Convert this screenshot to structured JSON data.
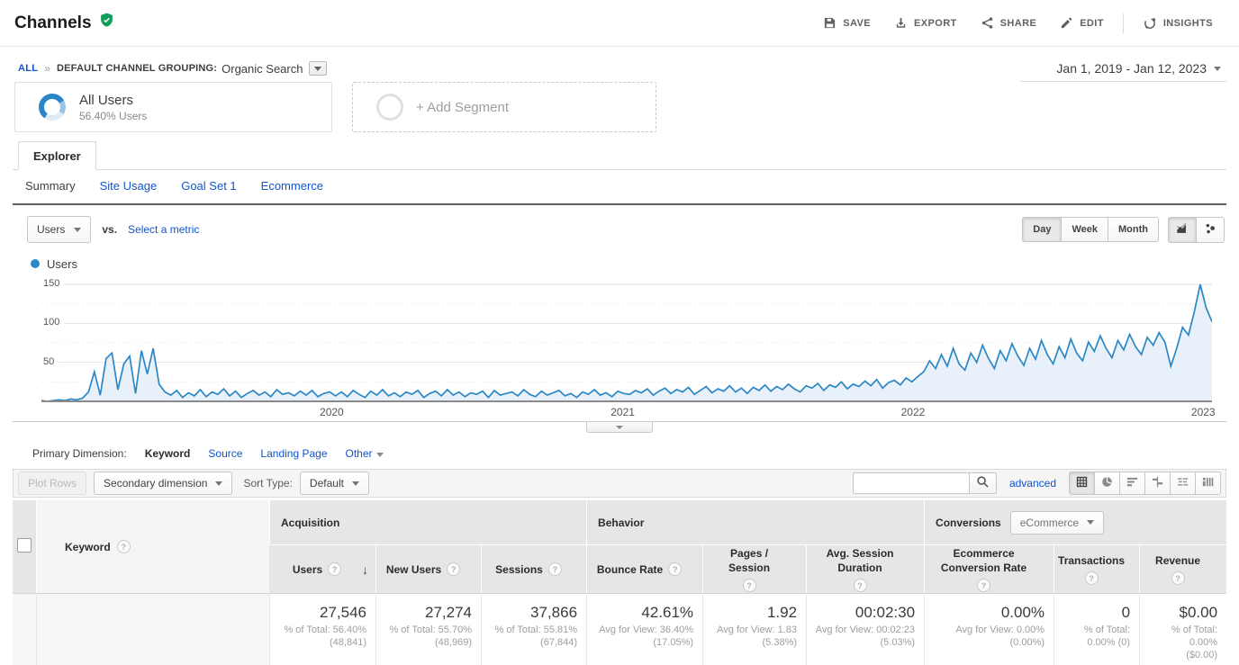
{
  "colors": {
    "accent_link": "#1155cc",
    "chart_line": "#2b87c5",
    "chart_fill": "#e8f1f9",
    "verified_green": "#0f9d58"
  },
  "header": {
    "title": "Channels",
    "actions": [
      {
        "name": "save",
        "label": "SAVE",
        "icon": "save-icon"
      },
      {
        "name": "export",
        "label": "EXPORT",
        "icon": "export-icon"
      },
      {
        "name": "share",
        "label": "SHARE",
        "icon": "share-icon"
      },
      {
        "name": "edit",
        "label": "EDIT",
        "icon": "edit-icon"
      },
      {
        "name": "insights",
        "label": "INSIGHTS",
        "icon": "insights-icon",
        "divider_before": true
      }
    ]
  },
  "breadcrumb": {
    "all": "ALL",
    "sep": "»",
    "grouping_label": "DEFAULT CHANNEL GROUPING:",
    "grouping_value": "Organic Search"
  },
  "date_range": "Jan 1, 2019 - Jan 12, 2023",
  "segments": {
    "all_users": {
      "title": "All Users",
      "subtitle": "56.40% Users",
      "percent": 56.4
    },
    "add_label": "+ Add Segment"
  },
  "explorer_tab": "Explorer",
  "subtabs": [
    {
      "label": "Summary",
      "active": true
    },
    {
      "label": "Site Usage",
      "active": false
    },
    {
      "label": "Goal Set 1",
      "active": false
    },
    {
      "label": "Ecommerce",
      "active": false
    }
  ],
  "metric_picker": {
    "selected": "Users",
    "vs": "vs.",
    "select_link": "Select a metric"
  },
  "granularity": {
    "options": [
      "Day",
      "Week",
      "Month"
    ],
    "active": "Day"
  },
  "chart_type_buttons": [
    {
      "name": "line-chart-view",
      "active": true
    },
    {
      "name": "motion-chart-view",
      "active": false
    }
  ],
  "legend": "Users",
  "chart_data": {
    "type": "line",
    "title": "Users",
    "x_start": "Jan 1, 2019",
    "x_end": "Jan 12, 2023",
    "x_ticks": [
      {
        "label": "2020",
        "frac": 0.248
      },
      {
        "label": "2021",
        "frac": 0.4966
      },
      {
        "label": "2022",
        "frac": 0.7446
      },
      {
        "label": "2023",
        "frac": 0.9925
      }
    ],
    "y_ticks": [
      50,
      100,
      150
    ],
    "y_midticks": [
      25,
      75,
      125
    ],
    "ylim": [
      0,
      165
    ],
    "grid": true,
    "legend_position": "top-left",
    "series": [
      {
        "name": "Users",
        "values": [
          1,
          0,
          1,
          2,
          1,
          3,
          2,
          4,
          12,
          38,
          8,
          55,
          62,
          15,
          48,
          58,
          10,
          65,
          35,
          68,
          22,
          12,
          8,
          14,
          5,
          11,
          7,
          15,
          6,
          12,
          9,
          16,
          7,
          13,
          5,
          10,
          14,
          8,
          12,
          6,
          15,
          9,
          11,
          7,
          13,
          8,
          14,
          6,
          10,
          12,
          7,
          12,
          6,
          14,
          9,
          5,
          13,
          8,
          15,
          7,
          11,
          6,
          12,
          9,
          14,
          5,
          10,
          13,
          7,
          15,
          8,
          12,
          6,
          11,
          9,
          13,
          5,
          14,
          8,
          10,
          12,
          7,
          15,
          9,
          6,
          13,
          8,
          11,
          14,
          7,
          10,
          5,
          12,
          9,
          15,
          8,
          11,
          6,
          13,
          10,
          9,
          14,
          11,
          16,
          8,
          13,
          17,
          10,
          15,
          12,
          18,
          9,
          14,
          19,
          11,
          16,
          13,
          20,
          12,
          17,
          10,
          18,
          14,
          21,
          13,
          19,
          15,
          22,
          16,
          12,
          20,
          17,
          23,
          14,
          21,
          18,
          25,
          16,
          22,
          19,
          26,
          20,
          28,
          17,
          24,
          27,
          21,
          30,
          25,
          32,
          38,
          52,
          42,
          60,
          45,
          68,
          48,
          40,
          62,
          50,
          72,
          55,
          42,
          65,
          52,
          74,
          58,
          46,
          68,
          54,
          78,
          60,
          48,
          70,
          56,
          80,
          62,
          52,
          76,
          64,
          84,
          68,
          56,
          78,
          66,
          86,
          70,
          60,
          82,
          72,
          88,
          76,
          45,
          68,
          95,
          85,
          115,
          150,
          120,
          102
        ]
      }
    ]
  },
  "primary_dimension": {
    "label": "Primary Dimension:",
    "options": [
      {
        "label": "Keyword",
        "active": true,
        "dropdown": false
      },
      {
        "label": "Source",
        "active": false,
        "dropdown": false
      },
      {
        "label": "Landing Page",
        "active": false,
        "dropdown": false
      },
      {
        "label": "Other",
        "active": false,
        "dropdown": true
      }
    ]
  },
  "table_toolbar": {
    "plot_rows": "Plot Rows",
    "secondary_dimension": "Secondary dimension",
    "sort_type_label": "Sort Type:",
    "sort_type_value": "Default",
    "search_placeholder": "",
    "advanced": "advanced",
    "view_buttons": [
      {
        "name": "data-view",
        "active": true
      },
      {
        "name": "percentage-view",
        "active": false
      },
      {
        "name": "performance-view",
        "active": false
      },
      {
        "name": "comparison-view",
        "active": false
      },
      {
        "name": "term-cloud-view",
        "active": false
      },
      {
        "name": "pivot-view",
        "active": false
      }
    ]
  },
  "table": {
    "row_header": "Keyword",
    "conversions_dropdown": "eCommerce",
    "groups": [
      {
        "label": "Acquisition",
        "span": 3,
        "dropdown": null
      },
      {
        "label": "Behavior",
        "span": 3,
        "dropdown": null
      },
      {
        "label": "Conversions",
        "span": 3,
        "dropdown": "eCommerce"
      }
    ],
    "columns": [
      {
        "label": "Users",
        "sorted": "desc"
      },
      {
        "label": "New Users",
        "sorted": null
      },
      {
        "label": "Sessions",
        "sorted": null
      },
      {
        "label": "Bounce Rate",
        "sorted": null
      },
      {
        "label": "Pages / Session",
        "sorted": null
      },
      {
        "label": "Avg. Session Duration",
        "sorted": null
      },
      {
        "label": "Ecommerce Conversion Rate",
        "sorted": null
      },
      {
        "label": "Transactions",
        "sorted": null
      },
      {
        "label": "Revenue",
        "sorted": null
      }
    ],
    "totals": [
      {
        "main": "27,546",
        "sub": "% of Total: 56.40%",
        "sub2": "(48,841)"
      },
      {
        "main": "27,274",
        "sub": "% of Total: 55.70%",
        "sub2": "(48,969)"
      },
      {
        "main": "37,866",
        "sub": "% of Total: 55.81%",
        "sub2": "(67,844)"
      },
      {
        "main": "42.61%",
        "sub": "Avg for View: 36.40%",
        "sub2": "(17.05%)"
      },
      {
        "main": "1.92",
        "sub": "Avg for View: 1.83",
        "sub2": "(5.38%)"
      },
      {
        "main": "00:02:30",
        "sub": "Avg for View: 00:02:23",
        "sub2": "(5.03%)"
      },
      {
        "main": "0.00%",
        "sub": "Avg for View: 0.00%",
        "sub2": "(0.00%)"
      },
      {
        "main": "0",
        "sub": "% of Total:",
        "sub2": "0.00% (0)"
      },
      {
        "main": "$0.00",
        "sub": "% of Total: 0.00%",
        "sub2": "($0.00)"
      }
    ]
  }
}
